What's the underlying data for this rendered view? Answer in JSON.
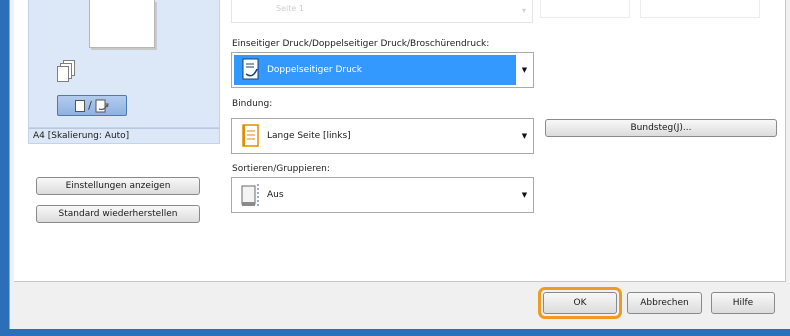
{
  "top": {
    "faded_combo": "Seite 1",
    "faded_field_1": "",
    "faded_field_2": ""
  },
  "left": {
    "scale_label": "A4 [Skalierung: Auto]",
    "show_settings_button": "Einstellungen anzeigen",
    "restore_defaults_button": "Standard wiederherstellen"
  },
  "print_mode": {
    "label": "Einseitiger Druck/Doppelseitiger Druck/Broschürendruck:",
    "value": "Doppelseitiger Druck"
  },
  "binding": {
    "label": "Bindung:",
    "value": "Lange Seite [links]",
    "gutter_button": "Bundsteg(J)..."
  },
  "collate": {
    "label": "Sortieren/Gruppieren:",
    "value": "Aus"
  },
  "footer": {
    "ok": "OK",
    "cancel": "Abbrechen",
    "help": "Hilfe"
  },
  "colors": {
    "highlight": "#3399ff",
    "ok_focus_ring": "#f29a1f",
    "preview_bg": "#dce8f7"
  }
}
